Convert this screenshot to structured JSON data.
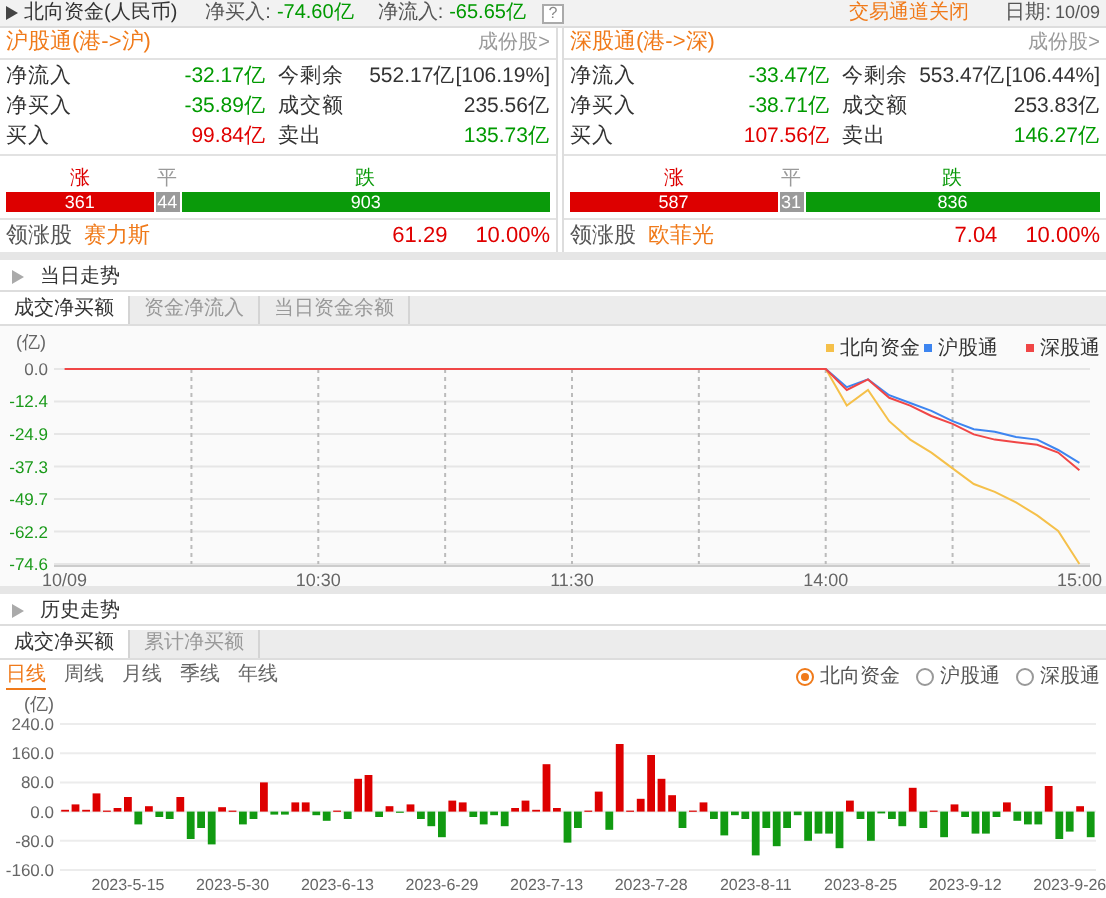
{
  "header": {
    "title": "北向资金(人民币)",
    "net_buy_label": "净买入:",
    "net_buy": "-74.60亿",
    "net_inflow_label": "净流入:",
    "net_inflow": "-65.65亿",
    "help": "?",
    "status": "交易通道关闭",
    "date_label": "日期:",
    "date": "10/09"
  },
  "panels": [
    {
      "title": "沪股通(港->沪)",
      "link": "成份股>",
      "rows": [
        [
          {
            "label": "净流入",
            "value": "-32.17亿",
            "color": "#009a00"
          },
          {
            "label": "今剩余",
            "value": "552.17亿[106.19%]",
            "color": "#333333"
          }
        ],
        [
          {
            "label": "净买入",
            "value": "-35.89亿",
            "color": "#009a00"
          },
          {
            "label": "成交额",
            "value": "235.56亿",
            "color": "#333333"
          }
        ],
        [
          {
            "label": "买入",
            "value": "99.84亿",
            "color": "#e00000"
          },
          {
            "label": "卖出",
            "value": "135.73亿",
            "color": "#009a00"
          }
        ]
      ],
      "breadth": [
        {
          "label": "涨",
          "count": "361",
          "color": "#dd0000"
        },
        {
          "label": "平",
          "count": "44",
          "color": "#9a9a9a"
        },
        {
          "label": "跌",
          "count": "903",
          "color": "#0a9a0a"
        }
      ],
      "leader": {
        "label": "领涨股",
        "name": "赛力斯",
        "price": "61.29",
        "change": "10.00%"
      }
    },
    {
      "title": "深股通(港->深)",
      "link": "成份股>",
      "rows": [
        [
          {
            "label": "净流入",
            "value": "-33.47亿",
            "color": "#009a00"
          },
          {
            "label": "今剩余",
            "value": "553.47亿[106.44%]",
            "color": "#333333"
          }
        ],
        [
          {
            "label": "净买入",
            "value": "-38.71亿",
            "color": "#009a00"
          },
          {
            "label": "成交额",
            "value": "253.83亿",
            "color": "#333333"
          }
        ],
        [
          {
            "label": "买入",
            "value": "107.56亿",
            "color": "#e00000"
          },
          {
            "label": "卖出",
            "value": "146.27亿",
            "color": "#009a00"
          }
        ]
      ],
      "breadth": [
        {
          "label": "涨",
          "count": "587",
          "color": "#dd0000"
        },
        {
          "label": "平",
          "count": "31",
          "color": "#9a9a9a"
        },
        {
          "label": "跌",
          "count": "836",
          "color": "#0a9a0a"
        }
      ],
      "leader": {
        "label": "领涨股",
        "name": "欧菲光",
        "price": "7.04",
        "change": "10.00%"
      }
    }
  ],
  "intraday": {
    "title": "当日走势",
    "tabs": [
      {
        "label": "成交净买额",
        "selected": true
      },
      {
        "label": "资金净流入",
        "selected": false
      },
      {
        "label": "当日资金余额",
        "selected": false
      }
    ],
    "chart_data": {
      "type": "line",
      "ylabel": "(亿)",
      "grid": true,
      "legend": true,
      "categories": [
        "10/09",
        null,
        null,
        null,
        null,
        null,
        null,
        null,
        null,
        null,
        null,
        null,
        "10:30",
        null,
        null,
        null,
        null,
        null,
        null,
        null,
        null,
        null,
        null,
        null,
        "11:30",
        null,
        null,
        null,
        null,
        null,
        null,
        null,
        null,
        null,
        null,
        null,
        "14:00",
        null,
        null,
        null,
        null,
        null,
        null,
        null,
        null,
        null,
        null,
        null,
        "15:00"
      ],
      "series": [
        {
          "name": "北向资金",
          "color": "#f5c04a",
          "values": [
            null,
            null,
            null,
            null,
            null,
            null,
            null,
            null,
            null,
            null,
            null,
            null,
            null,
            null,
            null,
            null,
            null,
            null,
            null,
            null,
            null,
            null,
            null,
            null,
            null,
            null,
            null,
            null,
            null,
            null,
            null,
            null,
            null,
            null,
            null,
            null,
            0,
            -14,
            -8,
            -20,
            -27,
            -32,
            -38,
            -44,
            -47,
            -51,
            -56,
            -62,
            -74.6
          ]
        },
        {
          "name": "沪股通",
          "color": "#3d85f0",
          "values": [
            null,
            null,
            null,
            null,
            null,
            null,
            null,
            null,
            null,
            null,
            null,
            null,
            null,
            null,
            null,
            null,
            null,
            null,
            null,
            null,
            null,
            null,
            null,
            null,
            null,
            null,
            null,
            null,
            null,
            null,
            null,
            null,
            null,
            null,
            null,
            null,
            0,
            -7,
            -4,
            -10,
            -13,
            -16,
            -20,
            -23,
            -24,
            -26,
            -27,
            -31,
            -35.9
          ]
        },
        {
          "name": "深股通",
          "color": "#f04646",
          "values": [
            0,
            0,
            0,
            0,
            0,
            0,
            0,
            0,
            0,
            0,
            0,
            0,
            0,
            0,
            0,
            0,
            0,
            0,
            0,
            0,
            0,
            0,
            0,
            0,
            0,
            0,
            0,
            0,
            0,
            0,
            0,
            0,
            0,
            0,
            0,
            0,
            0,
            -8,
            -4,
            -11,
            -14,
            -18,
            -21,
            -25,
            -27,
            -28,
            -29,
            -32,
            -38.7
          ]
        }
      ],
      "ylim": [
        -74.6,
        0
      ],
      "yticks": [
        {
          "value": 0,
          "label": "0.0"
        },
        {
          "value": -12.4,
          "label": "-12.4"
        },
        {
          "value": -24.9,
          "label": "-24.9"
        },
        {
          "value": -37.3,
          "label": "-37.3"
        },
        {
          "value": -49.7,
          "label": "-49.7"
        },
        {
          "value": -62.2,
          "label": "-62.2"
        },
        {
          "value": -74.6,
          "label": "-74.6"
        }
      ]
    }
  },
  "history": {
    "title": "历史走势",
    "tabs": [
      {
        "label": "成交净买额",
        "selected": true
      },
      {
        "label": "累计净买额",
        "selected": false
      }
    ],
    "periods": [
      {
        "label": "日线",
        "selected": true
      },
      {
        "label": "周线",
        "selected": false
      },
      {
        "label": "月线",
        "selected": false
      },
      {
        "label": "季线",
        "selected": false
      },
      {
        "label": "年线",
        "selected": false
      }
    ],
    "sources": [
      {
        "label": "北向资金",
        "selected": true
      },
      {
        "label": "沪股通",
        "selected": false
      },
      {
        "label": "深股通",
        "selected": false
      }
    ],
    "chart_data": {
      "type": "bar",
      "ylabel": "(亿)",
      "grid": true,
      "categories": [
        null,
        null,
        null,
        null,
        null,
        null,
        "2023-5-15",
        null,
        null,
        null,
        null,
        null,
        null,
        null,
        null,
        null,
        "2023-5-30",
        null,
        null,
        null,
        null,
        null,
        null,
        null,
        null,
        null,
        "2023-6-13",
        null,
        null,
        null,
        null,
        null,
        null,
        null,
        null,
        null,
        "2023-6-29",
        null,
        null,
        null,
        null,
        null,
        null,
        null,
        null,
        null,
        "2023-7-13",
        null,
        null,
        null,
        null,
        null,
        null,
        null,
        null,
        null,
        "2023-7-28",
        null,
        null,
        null,
        null,
        null,
        null,
        null,
        null,
        null,
        "2023-8-11",
        null,
        null,
        null,
        null,
        null,
        null,
        null,
        null,
        null,
        "2023-8-25",
        null,
        null,
        null,
        null,
        null,
        null,
        null,
        null,
        null,
        "2023-9-12",
        null,
        null,
        null,
        null,
        null,
        null,
        null,
        null,
        null,
        "2023-9-26",
        null,
        null
      ],
      "series": [
        {
          "color": "#dd0000",
          "values": [
            5,
            20,
            5,
            50,
            3,
            10,
            40,
            null,
            15,
            null,
            null,
            40,
            null,
            null,
            null,
            12,
            3,
            null,
            null,
            80,
            null,
            null,
            25,
            25,
            null,
            null,
            3,
            null,
            90,
            100,
            null,
            15,
            null,
            20,
            null,
            null,
            null,
            30,
            25,
            null,
            null,
            null,
            null,
            10,
            30,
            5,
            130,
            10,
            null,
            null,
            3,
            55,
            null,
            185,
            3,
            35,
            155,
            90,
            45,
            null,
            3,
            25,
            null,
            null,
            null,
            null,
            null,
            null,
            null,
            null,
            null,
            null,
            null,
            null,
            null,
            30,
            null,
            null,
            null,
            null,
            null,
            65,
            null,
            3,
            null,
            20,
            null,
            null,
            null,
            null,
            25,
            null,
            null,
            null,
            70,
            null,
            null,
            15,
            null
          ]
        },
        {
          "color": "#119a11",
          "values": [
            null,
            null,
            null,
            null,
            null,
            null,
            null,
            -35,
            null,
            -15,
            -20,
            null,
            -75,
            -45,
            -90,
            null,
            null,
            -35,
            -20,
            null,
            -8,
            -8,
            null,
            null,
            -10,
            -25,
            null,
            -20,
            null,
            null,
            -15,
            null,
            -3,
            null,
            -20,
            -40,
            -70,
            null,
            null,
            -15,
            -35,
            -10,
            -40,
            null,
            null,
            null,
            null,
            null,
            -85,
            -45,
            null,
            null,
            -50,
            null,
            null,
            null,
            null,
            null,
            null,
            -45,
            null,
            null,
            -20,
            -65,
            -10,
            -20,
            -120,
            -45,
            -95,
            -45,
            -10,
            -80,
            -60,
            -60,
            -100,
            null,
            -20,
            -80,
            -5,
            -20,
            -40,
            null,
            -45,
            null,
            -70,
            null,
            -15,
            -60,
            -60,
            -15,
            null,
            -25,
            -35,
            -35,
            null,
            -75,
            -55,
            null,
            -70
          ]
        }
      ],
      "ylim": [
        -160,
        240
      ],
      "yticks": [
        {
          "value": 240,
          "label": "240.0"
        },
        {
          "value": 160,
          "label": "160.0"
        },
        {
          "value": 80,
          "label": "80.0"
        },
        {
          "value": 0,
          "label": "0.0"
        },
        {
          "value": -80,
          "label": "-80.0"
        },
        {
          "value": -160,
          "label": "-160.0"
        }
      ]
    }
  }
}
